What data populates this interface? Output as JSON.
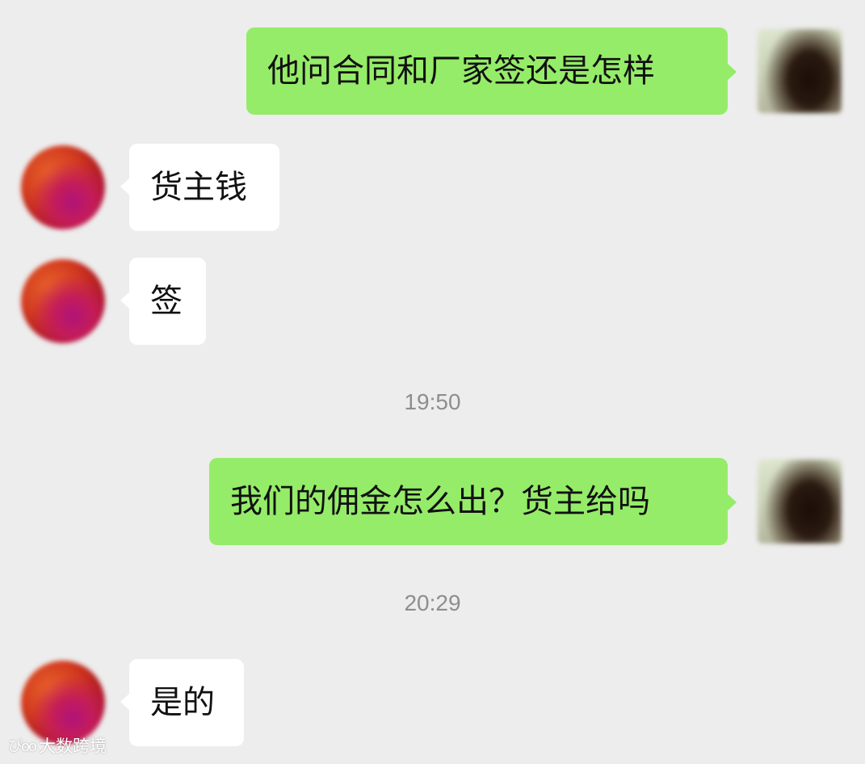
{
  "messages": [
    {
      "sender": "self",
      "text": "他问合同和厂家签还是怎样"
    },
    {
      "sender": "other",
      "text": "货主钱"
    },
    {
      "sender": "other",
      "text": "签"
    },
    {
      "sender": "self",
      "text": "我们的佣金怎么出？货主给吗"
    },
    {
      "sender": "other",
      "text": "是的"
    }
  ],
  "timestamps": [
    "19:50",
    "20:29"
  ],
  "watermark": {
    "logo": "ぴoo",
    "text": "大数跨境"
  },
  "colors": {
    "background": "#ededed",
    "self_bubble": "#95ec69",
    "other_bubble": "#ffffff",
    "timestamp_text": "#8e8e8e"
  },
  "icons": {
    "self_avatar": "avatar-self-blurred",
    "other_avatar": "avatar-other-blurred"
  }
}
